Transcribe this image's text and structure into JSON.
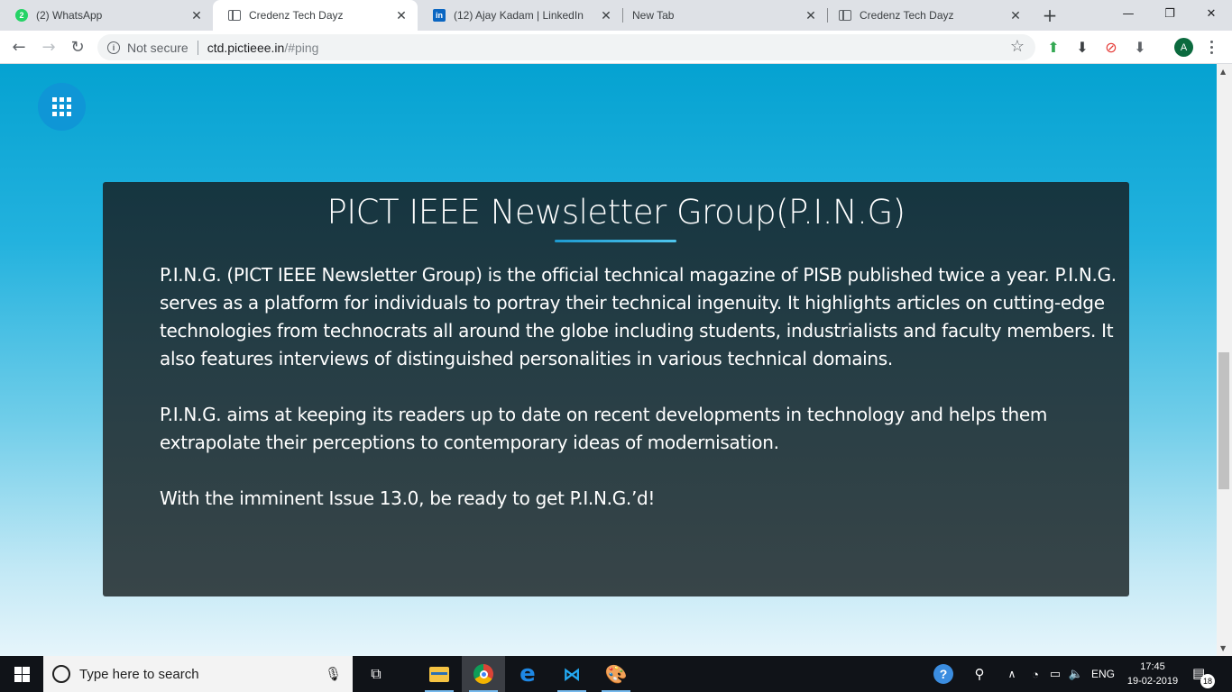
{
  "browser": {
    "tabs": [
      {
        "title": "(2) WhatsApp",
        "icon": "whatsapp-icon",
        "badge": "2"
      },
      {
        "title": "Credenz Tech Dayz",
        "icon": "page-icon",
        "active": true
      },
      {
        "title": "(12) Ajay Kadam | LinkedIn",
        "icon": "linkedin-icon",
        "badge": "in"
      },
      {
        "title": "New Tab",
        "icon": "none"
      },
      {
        "title": "Credenz Tech Dayz",
        "icon": "page-icon"
      }
    ],
    "new_tab_symbol": "+",
    "window_controls": {
      "minimize": "—",
      "maximize": "❐",
      "close": "✕"
    },
    "address_bar": {
      "security_label": "Not secure",
      "host": "ctd.pictieee.in",
      "path": "/#ping"
    },
    "profile_initial": "A"
  },
  "page": {
    "card": {
      "title": "PICT IEEE Newsletter Group(P.I.N.G)",
      "paragraphs": [
        "P.I.N.G. (PICT IEEE Newsletter Group) is the official technical magazine of PISB published twice a year. P.I.N.G. serves as a platform for individuals to portray their technical ingenuity. It highlights articles on cutting-edge technologies from technocrats all around the globe including students, industrialists and faculty members. It also features interviews of distinguished personalities in various technical domains.",
        "P.I.N.G. aims at keeping its readers up to date on recent developments in technology and helps them extrapolate their perceptions to contemporary ideas of modernisation.",
        "With the imminent Issue 13.0, be ready to get P.I.N.G.’d!"
      ]
    },
    "colors": {
      "background_top": "#05a2d1",
      "card_background": "#253d45",
      "accent": "#1e9bd1"
    }
  },
  "taskbar": {
    "search_placeholder": "Type here to search",
    "language": "ENG",
    "time": "17:45",
    "date": "19-02-2019",
    "notification_count": "18"
  }
}
